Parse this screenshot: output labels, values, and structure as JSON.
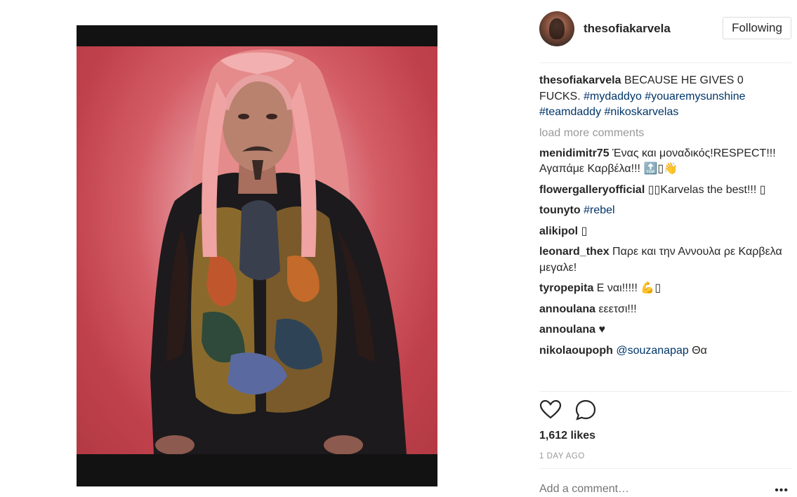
{
  "post": {
    "image_alt": "Man with long pink-red hair and a dark patterned jacket against a red background",
    "username": "thesofiakarvela",
    "follow_label": "Following",
    "caption": {
      "user": "thesofiakarvela",
      "text": "BECAUSE HE GIVES 0 FUCKS.",
      "tags": [
        "#mydaddyo",
        "#youaremysunshine",
        "#teamdaddy",
        "#nikoskarvelas"
      ]
    },
    "load_more": "load more comments",
    "comments": [
      {
        "user": "menidimitr75",
        "text": "Ένας και μοναδικός!RESPECT!!!Αγαπάμε Καρβέλα!!! 🔝▯👋"
      },
      {
        "user": "flowergalleryofficial",
        "text": "▯▯Karvelas the best!!! ▯"
      },
      {
        "user": "tounyto",
        "tag": "#rebel"
      },
      {
        "user": "alikipol",
        "text": "▯"
      },
      {
        "user": "leonard_thex",
        "text": "Παρε και την Αννουλα ρε Καρβελα μεγαλε!"
      },
      {
        "user": "tyropepita",
        "text": "Ε ναι!!!!! 💪▯"
      },
      {
        "user": "annoulana",
        "text": "εεετσι!!!"
      },
      {
        "user": "annoulana",
        "text": "♥"
      },
      {
        "user": "nikolaoupoph",
        "mention": "@souzanapap",
        "text": " Θα"
      }
    ],
    "likes": "1,612 likes",
    "date": "1 DAY AGO",
    "add_comment_placeholder": "Add a comment…",
    "more_label": "•••",
    "icons": {
      "like": "heart-icon",
      "comment": "comment-bubble-icon",
      "more": "more-options-icon"
    }
  }
}
